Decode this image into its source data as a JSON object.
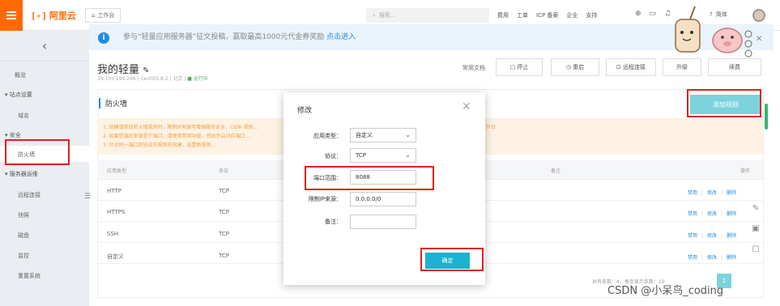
{
  "topbar": {
    "logo_text": "阿里云",
    "workbench": "工作台",
    "search_placeholder": "搜索...",
    "nav": [
      "费用",
      "工单",
      "ICP 备案",
      "企业",
      "支持"
    ],
    "help": "简体",
    "brand_color": "#ff6a00"
  },
  "sidebar": {
    "collapse_icon": "chevron-left-icon",
    "items": {
      "overview": "概览",
      "site_settings": "站点设置",
      "domain": "域名",
      "security": "安全",
      "firewall": "防火墙",
      "server_ops": "服务器运维",
      "remote": "远程连接",
      "snapshot": "快照",
      "disk": "磁盘",
      "monitor": "监控",
      "reset": "重置系统"
    }
  },
  "notice": {
    "text": "参与“轻量应用服务器”征文投稿，赢取最高1000元代金券奖励",
    "link": "点击进入"
  },
  "page": {
    "title": "我的轻量",
    "ip": "39.105.194.246",
    "os": "CentOS 8.2",
    "region": "北京",
    "status": "运行中",
    "docs": "常用文档",
    "buttons": {
      "stop": "停止",
      "restart": "重启",
      "remote": "远程连接",
      "upgrade": "升级",
      "renew": "续费"
    }
  },
  "firewall": {
    "title": "防火墙",
    "add_rule": "添加规则",
    "warnings": [
      "1. 创建或修改防火墙规则时，限制IP来源可增强服务安全，CIDR 规则…",
      "2. 如果您端的来源是个端口，请使用禁用功能，然后开启对应端口…",
      "3. 针对同一端口的协议的规则的创建，设置新规则…"
    ],
    "warning_tail": "开台",
    "columns": [
      "应用类型",
      "协议",
      "备注",
      "操作"
    ],
    "rows": [
      {
        "app": "HTTP",
        "proto": "TCP"
      },
      {
        "app": "HTTPS",
        "proto": "TCP"
      },
      {
        "app": "SSH",
        "proto": "TCP"
      },
      {
        "app": "自定义",
        "proto": "TCP"
      }
    ],
    "actions": {
      "disable": "禁用",
      "edit": "修改",
      "delete": "删除"
    },
    "pager": "共有条数：4，每页显示条数：10",
    "current_page": "1"
  },
  "modal": {
    "title": "修改",
    "labels": {
      "app_type": "应用类型：",
      "protocol": "协议：",
      "port_range": "端口范围：",
      "source_ip": "限制IP来源：",
      "remark": "备注："
    },
    "values": {
      "app_type": "自定义",
      "protocol": "TCP",
      "port_range": "8088",
      "source_ip": "0.0.0.0/0",
      "remark": ""
    },
    "confirm": "确定"
  },
  "watermark": "CSDN @小呆鸟_coding"
}
